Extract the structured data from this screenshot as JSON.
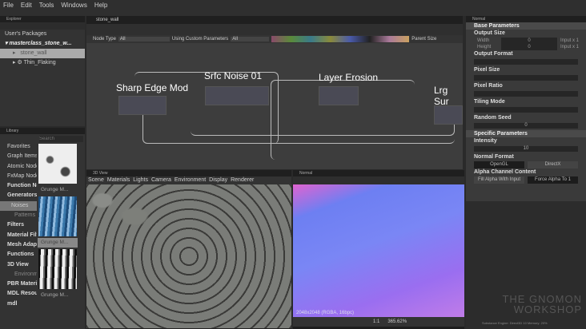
{
  "menu": [
    "File",
    "Edit",
    "Tools",
    "Windows",
    "Help"
  ],
  "explorer": {
    "title": "Explorer",
    "root": "User's Packages",
    "package": "masterclass_stone_w...",
    "items": [
      "stone_wall",
      "Thin_Flaking"
    ]
  },
  "library": {
    "title": "Library",
    "search_placeholder": "Search",
    "categories": [
      "Favorites",
      "Graph Items",
      "Atomic Nodes",
      "FxMap Nodes",
      "Function Nodes",
      "Generators",
      "Noises",
      "Patterns",
      "Filters",
      "Material Filters",
      "Mesh Adaptive",
      "Functions",
      "3D View",
      "Environment",
      "PBR Materials",
      "MDL Resources",
      "mdl"
    ],
    "thumbs": [
      "Grunge M...",
      "Grunge M...",
      "Grunge M..."
    ]
  },
  "graph": {
    "tab": "stone_wall",
    "node_type_label": "Node Type",
    "node_type_value": "All",
    "custom_params_label": "Using Custom Parameters",
    "custom_params_value": "All",
    "parent_size": "Parent Size",
    "nodes": [
      "Sharp Edge Mod",
      "Srfc Noise 01",
      "Layer Erosion",
      "Lrg Sur"
    ]
  },
  "view3d": {
    "title": "3D View",
    "menu": [
      "Scene",
      "Materials",
      "Lights",
      "Camera",
      "Environment",
      "Display",
      "Renderer"
    ]
  },
  "view2d": {
    "title": "Normal",
    "info": "2048x2048 (RGBA, 16bpc)",
    "ratio": "1:1",
    "zoom": "365.62%"
  },
  "params": {
    "title": "Normal",
    "base": "Base Parameters",
    "output_size": "Output Size",
    "width": "Width",
    "height": "Height",
    "w_val": "0",
    "h_val": "0",
    "w_mode": "Input x 1",
    "h_mode": "Input x 1",
    "output_format": "Output Format",
    "pixel_size": "Pixel Size",
    "pixel_ratio": "Pixel Ratio",
    "tiling_mode": "Tiling Mode",
    "random_seed": "Random Seed",
    "seed_val": "0",
    "specific": "Specific Parameters",
    "intensity": "Intensity",
    "intensity_val": "10",
    "normal_format": "Normal Format",
    "opengl": "OpenGL",
    "directx": "DirectX",
    "alpha": "Alpha Channel Content",
    "fill_alpha": "Fill Alpha With Input",
    "force_alpha": "Force Alpha To 1"
  },
  "status": "Substance Engine: Direct3D 10  Memory: 20%",
  "watermark": "THE GNOMON WORKSHOP"
}
